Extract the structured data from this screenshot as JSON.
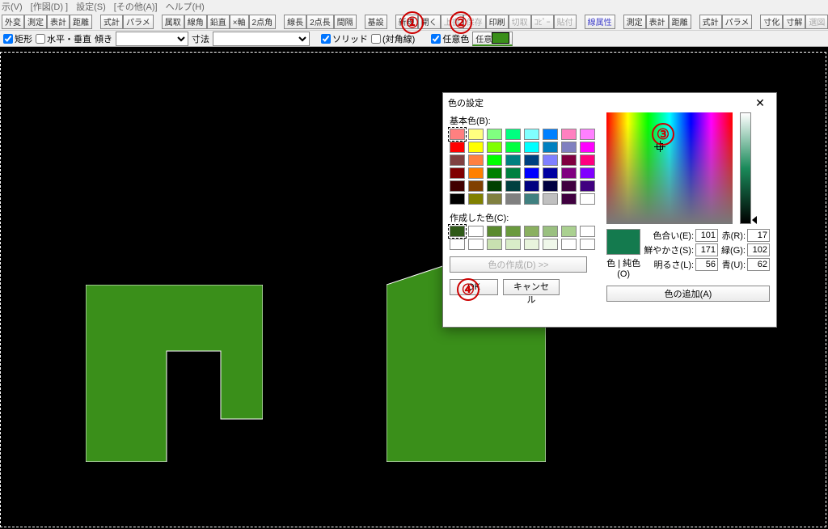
{
  "menu": [
    "示(V)",
    "[作図(D) ]",
    "設定(S)",
    "[その他(A)]",
    "ヘルプ(H)"
  ],
  "toolbar": {
    "g1": [
      "外変",
      "測定",
      "表計",
      "距離"
    ],
    "g2": [
      "式計",
      "パラメ"
    ],
    "g3": [
      "属取",
      "線角",
      "鉛直",
      "×軸",
      "2点角"
    ],
    "g4": [
      "線長",
      "2点長",
      "間隔"
    ],
    "g5": [
      "基設"
    ],
    "g6": [
      "新規",
      "開く",
      "上書",
      "保存",
      "印刷",
      "切取",
      "ｺﾋﾟｰ",
      "貼付"
    ],
    "g7": [
      "線属性"
    ],
    "g8": [
      "測定",
      "表計",
      "距離"
    ],
    "g9": [
      "式計",
      "パラメ"
    ],
    "g10": [
      "寸化",
      "寸解",
      "選図"
    ]
  },
  "opt": {
    "rect_label": "矩形",
    "hv_label": "水平・垂直",
    "tilt_label": "傾き",
    "dim_label": "寸法",
    "solid_label": "ソリッド",
    "diag_label": "(対角線)",
    "arbcol_label": "任意色",
    "arbcol2_label": "任意"
  },
  "dlg": {
    "title": "色の設定",
    "basic_label": "基本色(B):",
    "custom_label": "作成した色(C):",
    "make_label": "色の作成(D) >>",
    "ok": "OK",
    "cancel": "キャンセル",
    "hue_label": "色合い(E):",
    "sat_label": "鮮やかさ(S):",
    "lum_label": "明るさ(L):",
    "r_label": "赤(R):",
    "g_label": "緑(G):",
    "b_label": "青(U):",
    "hue": "101",
    "sat": "171",
    "lum": "56",
    "r": "17",
    "g": "102",
    "b": "62",
    "colmodel": "色 | 純色(O)",
    "add": "色の追加(A)"
  },
  "basic_colors": [
    [
      "#ff8080",
      "#ffff80",
      "#80ff80",
      "#00ff80",
      "#80ffff",
      "#0080ff",
      "#ff80c0",
      "#ff80ff"
    ],
    [
      "#ff0000",
      "#ffff00",
      "#80ff00",
      "#00ff40",
      "#00ffff",
      "#0080c0",
      "#8080c0",
      "#ff00ff"
    ],
    [
      "#804040",
      "#ff8040",
      "#00ff00",
      "#008080",
      "#004080",
      "#8080ff",
      "#800040",
      "#ff0080"
    ],
    [
      "#800000",
      "#ff8000",
      "#008000",
      "#008040",
      "#0000ff",
      "#0000a0",
      "#800080",
      "#8000ff"
    ],
    [
      "#400000",
      "#804000",
      "#004000",
      "#004040",
      "#000080",
      "#000040",
      "#400040",
      "#400080"
    ],
    [
      "#000000",
      "#808000",
      "#808040",
      "#808080",
      "#408080",
      "#c0c0c0",
      "#400040",
      "#ffffff"
    ]
  ],
  "custom_row1": [
    "#2f5a18",
    "#ffffff",
    "#5a8a2e",
    "#6a9a3e",
    "#8ab060",
    "#9ac080",
    "#aad090",
    "#ffffff"
  ],
  "custom_row2": [
    "#ffffff",
    "#ffffff",
    "#c8e0b0",
    "#d8ecc8",
    "#e8f4dc",
    "#f0f8ea",
    "#ffffff",
    "#ffffff"
  ],
  "ann": {
    "a1": "①",
    "a2": "②",
    "a3": "③",
    "a4": "④"
  }
}
